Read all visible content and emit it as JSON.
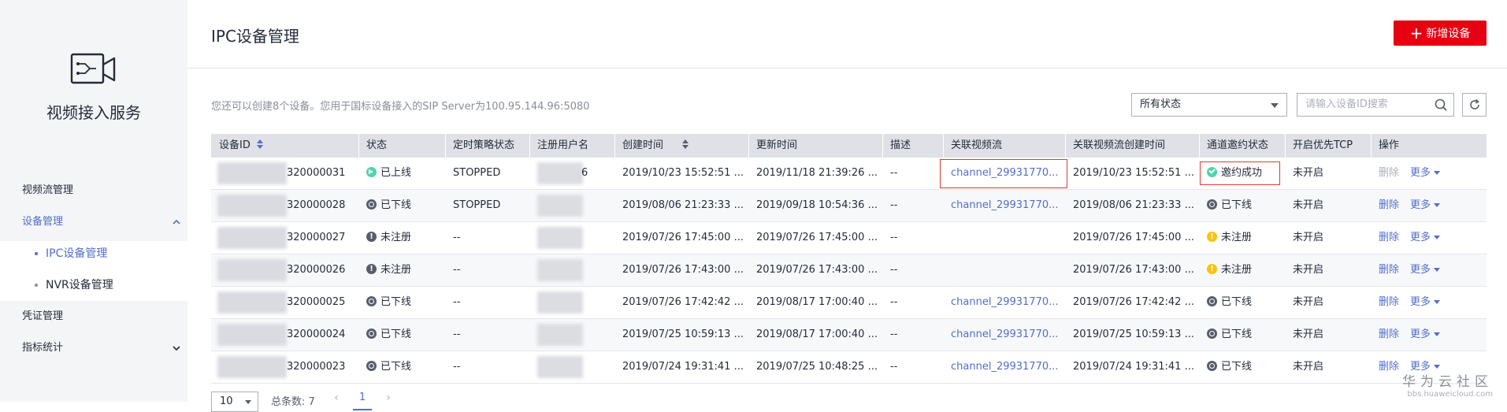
{
  "sidebar": {
    "service_title": "视频接入服务",
    "items": [
      {
        "label": "视频流管理"
      },
      {
        "label": "设备管理",
        "expanded": true
      },
      {
        "label": "凭证管理"
      },
      {
        "label": "指标统计",
        "expanded": false
      }
    ],
    "sub_items": [
      {
        "label": "IPC设备管理",
        "active": true
      },
      {
        "label": "NVR设备管理",
        "active": false
      }
    ]
  },
  "header": {
    "title": "IPC设备管理",
    "add_button": "新增设备"
  },
  "toolbar": {
    "tip": "您还可以创建8个设备。您用于国标设备接入的SIP Server为100.95.144.96:5080",
    "status_filter": "所有状态",
    "search_placeholder": "请输入设备ID搜索"
  },
  "table": {
    "columns": [
      "设备ID",
      "状态",
      "定时策略状态",
      "注册用户名",
      "创建时间",
      "更新时间",
      "描述",
      "关联视频流",
      "关联视频流创建时间",
      "通道邀约状态",
      "开启优先TCP",
      "操作"
    ],
    "rows": [
      {
        "device_id_suffix": "320000031",
        "status": "已上线",
        "status_type": "online",
        "policy": "STOPPED",
        "user_suffix": "6",
        "created": "2019/10/23 15:52:51 ...",
        "updated": "2019/11/18 21:39:26 ...",
        "desc": "--",
        "stream": "channel_29931770...",
        "stream_created": "2019/10/23 15:52:51 ...",
        "invite": "邀约成功",
        "invite_type": "success",
        "tcp": "未开启",
        "delete": "删除",
        "delete_disabled": true,
        "more": "更多"
      },
      {
        "device_id_suffix": "320000028",
        "status": "已下线",
        "status_type": "offline",
        "policy": "STOPPED",
        "user_suffix": "",
        "created": "2019/08/06 21:23:33 ...",
        "updated": "2019/09/18 10:54:36 ...",
        "desc": "--",
        "stream": "channel_29931770...",
        "stream_created": "2019/08/06 21:23:33 ...",
        "invite": "已下线",
        "invite_type": "offline",
        "tcp": "未开启",
        "delete": "删除",
        "delete_disabled": false,
        "more": "更多"
      },
      {
        "device_id_suffix": "320000027",
        "status": "未注册",
        "status_type": "unreg",
        "policy": "--",
        "user_suffix": "",
        "created": "2019/07/26 17:45:00 ...",
        "updated": "2019/07/26 17:45:00 ...",
        "desc": "--",
        "stream": "",
        "stream_created": "2019/07/26 17:45:00 ...",
        "invite": "未注册",
        "invite_type": "warn",
        "tcp": "未开启",
        "delete": "删除",
        "delete_disabled": false,
        "more": "更多"
      },
      {
        "device_id_suffix": "320000026",
        "status": "未注册",
        "status_type": "unreg",
        "policy": "--",
        "user_suffix": "",
        "created": "2019/07/26 17:43:00 ...",
        "updated": "2019/07/26 17:43:00 ...",
        "desc": "--",
        "stream": "",
        "stream_created": "2019/07/26 17:43:00 ...",
        "invite": "未注册",
        "invite_type": "warn",
        "tcp": "未开启",
        "delete": "删除",
        "delete_disabled": false,
        "more": "更多"
      },
      {
        "device_id_suffix": "320000025",
        "status": "已下线",
        "status_type": "offline",
        "policy": "--",
        "user_suffix": "",
        "created": "2019/07/26 17:42:42 ...",
        "updated": "2019/08/17 17:00:40 ...",
        "desc": "--",
        "stream": "channel_29931770...",
        "stream_created": "2019/07/26 17:42:42 ...",
        "invite": "已下线",
        "invite_type": "offline",
        "tcp": "未开启",
        "delete": "删除",
        "delete_disabled": false,
        "more": "更多"
      },
      {
        "device_id_suffix": "320000024",
        "status": "已下线",
        "status_type": "offline",
        "policy": "--",
        "user_suffix": "",
        "created": "2019/07/25 10:59:13 ...",
        "updated": "2019/08/17 17:00:40 ...",
        "desc": "--",
        "stream": "channel_29931770...",
        "stream_created": "2019/07/25 10:59:13 ...",
        "invite": "已下线",
        "invite_type": "offline",
        "tcp": "未开启",
        "delete": "删除",
        "delete_disabled": false,
        "more": "更多"
      },
      {
        "device_id_suffix": "320000023",
        "status": "已下线",
        "status_type": "offline",
        "policy": "--",
        "user_suffix": "",
        "created": "2019/07/24 19:31:41 ...",
        "updated": "2019/07/25 10:48:25 ...",
        "desc": "--",
        "stream": "channel_29931770...",
        "stream_created": "2019/07/24 19:31:41 ...",
        "invite": "已下线",
        "invite_type": "offline",
        "tcp": "未开启",
        "delete": "删除",
        "delete_disabled": false,
        "more": "更多"
      }
    ]
  },
  "pagination": {
    "page_size": "10",
    "total": "总条数: 7",
    "current_page": "1"
  },
  "watermark": {
    "line1": "华为云社区",
    "line2": "bbs.huaweicloud.com"
  },
  "colors": {
    "accent": "#526ecc",
    "brand_red": "#e60012",
    "success": "#50d4ab",
    "warning": "#fac20a"
  }
}
